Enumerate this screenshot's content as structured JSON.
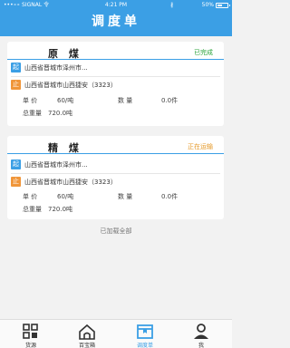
{
  "status_bar": {
    "carrier": "•••∘∘ SIGNAL",
    "wifi": "令",
    "time": "4:21 PM",
    "bluetooth": "∦",
    "battery": "50%"
  },
  "header": {
    "title": "调度单"
  },
  "orders": [
    {
      "cargo": "原 煤",
      "status": "已完成",
      "start_tag": "起",
      "start_address": "山西省晋城市泽州市...",
      "end_tag": "止",
      "end_address": "山西省晋城市山西捷安（3323）",
      "price_label": "单  价",
      "price_value": "60/吨",
      "qty_label": "数  量",
      "qty_value": "0.0件",
      "weight_label": "总重量",
      "weight_value": "720.0吨"
    },
    {
      "cargo": "精 煤",
      "status": "正在运输",
      "start_tag": "起",
      "start_address": "山西省晋城市泽州市...",
      "end_tag": "止",
      "end_address": "山西省晋城市山西捷安（3323）",
      "price_label": "单  价",
      "price_value": "60/吨",
      "qty_label": "数  量",
      "qty_value": "0.0件",
      "weight_label": "总重量",
      "weight_value": "720.0吨"
    }
  ],
  "footer_text": "已加载全部",
  "tabs": [
    {
      "label": "货源",
      "icon": "grid-icon"
    },
    {
      "label": "百宝箱",
      "icon": "home-icon"
    },
    {
      "label": "调度单",
      "icon": "box-icon",
      "active": true
    },
    {
      "label": "我",
      "icon": "user-icon"
    }
  ],
  "colors": {
    "primary": "#3b9fe5",
    "done": "#2aa33a",
    "in_transit": "#e59a2a",
    "end_tag": "#f0963a"
  }
}
